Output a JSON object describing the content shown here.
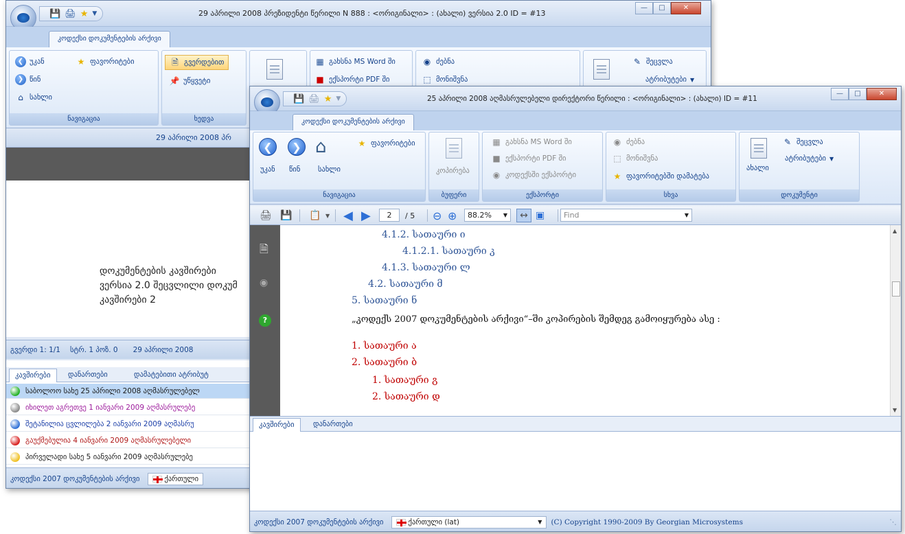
{
  "back_window": {
    "title": "29 აპრილი 2008 პრეზიდენტი წერილი N 888 : <ორიგინალი> : (ახალი) ვერსია 2.0 ID = #13",
    "ribbon_tab": "კოდექსი დოკუმენტების არქივი",
    "nav_back": "უკან",
    "nav_fav": "ფავორიტები",
    "nav_forward": "წინ",
    "nav_home": "სახლი",
    "btn_pages": "გვერდებით",
    "btn_find": "უწყვეტი",
    "btn_open_word": "გახსნა MS Word ში",
    "btn_export_pdf": "ექსპორტი PDF ში",
    "btn_search": "ძებნა",
    "btn_mark": "მონიშვნა",
    "btn_edit": "შეცვლა",
    "btn_attributes": "ატრიბუტები",
    "group_nav": "ნავიგაცია",
    "group_view": "ხედვა",
    "header_date": "29 აპრილი 2008 პრ",
    "doc_text": [
      "დოკუმენტების კავშირები",
      "ვერსია 2.0 შეცვლილი დოკუმ",
      "კავშირები 2"
    ],
    "status": {
      "page": "გვერდი  1: 1/1",
      "pos": "სტრ. 1 პოზ. 0",
      "date": "29 აპრილი 2008"
    },
    "tabs": [
      "კავშირები",
      "დანართები",
      "დამატებითი ატრიბუტ"
    ],
    "links": [
      {
        "text": "საბოლოო სახე 25 აპრილი 2008  აღმასრულებელ",
        "color": "#1a1a1a",
        "dot": "#21b021"
      },
      {
        "text": "იხილეთ აგრეთვე 1 იანვარი 2009  აღმასრულებე",
        "color": "#9c1b9c",
        "dot": "#8a8a8a"
      },
      {
        "text": "შეტანილია ცვლილება 2 იანვარი 2009  აღმასრუ",
        "color": "#1c3fa8",
        "dot": "#2d6fd6"
      },
      {
        "text": "გაუქმებულია 4 იანვარი 2009  აღმასრულებელი",
        "color": "#b01818",
        "dot": "#d81e1e"
      },
      {
        "text": "პირველადი სახე 5 იანვარი 2009  აღმასრულებე",
        "color": "#222222",
        "dot": "#f0c020"
      }
    ],
    "footer_archive": "კოდექსი 2007 დოკუმენტების არქივი",
    "footer_lang": "ქართული"
  },
  "front_window": {
    "title": "25 აპრილი 2008 აღმასრულებელი დირექტორი წერილი : <ორიგინალი> : (ახალი) ID = #11",
    "ribbon_tab": "კოდექსი დოკუმენტების არქივი",
    "nav_fav": "ფავორიტები",
    "nav_back": "უკან",
    "nav_forward": "წინ",
    "nav_home": "სახლი",
    "btn_copy": "კოპირება",
    "btn_open_word": "გახსნა MS Word ში",
    "btn_export_pdf": "ექსპორტი PDF ში",
    "btn_export_codex": "კოდექსში ექსპორტი",
    "btn_search": "ძებნა",
    "btn_mark": "მონიშვნა",
    "btn_add_fav": "ფავორიტებში დამატება",
    "btn_new": "ახალი",
    "btn_edit": "შეცვლა",
    "btn_attributes": "ატრიბუტები",
    "groups": [
      "ნავიგაცია",
      "ბუფერი",
      "ექსპორტი",
      "სხვა",
      "დოკუმენტი"
    ],
    "toolbar": {
      "page": "2",
      "total": "/ 5",
      "zoom": "88.2%",
      "find_placeholder": "Find"
    },
    "doc_lines": [
      {
        "text": "4.1.2.  სათაური ი",
        "color": "#2f5597"
      },
      {
        "text": "4.1.2.1.      სათაური კ",
        "color": "#2f5597"
      },
      {
        "text": "4.1.3.  სათაური ლ",
        "color": "#2f5597"
      },
      {
        "text": "4.2. სათაური მ",
        "color": "#2f5597"
      },
      {
        "text": "5.  სათაური ნ",
        "color": "#2f5597"
      },
      {
        "text": "„კოდექს 2007 დოკუმენტების არქივი“–ში კოპირების შემდეგ გამოიყურება ასე :",
        "color": "#111111"
      },
      {
        "text": "1.  სათაური ა",
        "color": "#c00000"
      },
      {
        "text": "2.  სათაური ბ",
        "color": "#c00000"
      },
      {
        "text": "1.   სათაური გ",
        "color": "#c00000"
      },
      {
        "text": "2.   სათაური დ",
        "color": "#c00000"
      }
    ],
    "tabs": [
      "კავშირები",
      "დანართები"
    ],
    "footer_archive": "კოდექსი 2007 დოკუმენტების არქივი",
    "footer_lang": "ქართული (lat)",
    "footer_copyright": "(C) Copyright 1990-2009 By Georgian Microsystems"
  }
}
